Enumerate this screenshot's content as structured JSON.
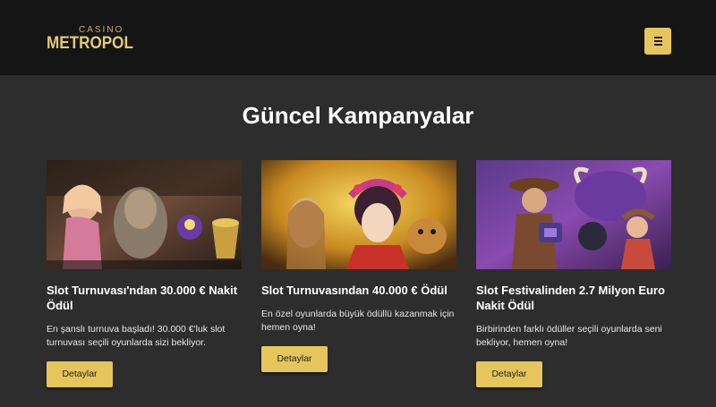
{
  "header": {
    "logo_top": "CASINO",
    "logo_main": "METROPOL",
    "menu_icon": "hamburger-menu-icon"
  },
  "page": {
    "title": "Güncel Kampanyalar"
  },
  "campaigns": [
    {
      "title": "Slot Turnuvası'ndan 30.000 € Nakit Ödül",
      "description": "En şanslı turnuva başladı! 30.000 €'luk slot turnuvası seçili oyunlarda sizi bekliyor.",
      "button": "Detaylar"
    },
    {
      "title": "Slot Turnuvasından 40.000 € Ödül",
      "description": "En özel oyunlarda büyük ödüllü kazanmak için hemen oyna!",
      "button": "Detaylar"
    },
    {
      "title": "Slot Festivalinden 2.7 Milyon Euro Nakit Ödül",
      "description": "Birbirinden farklı ödüller seçili oyunlarda seni bekliyor, hemen oyna!",
      "button": "Detaylar"
    }
  ],
  "colors": {
    "header_bg": "#151515",
    "page_bg": "#2d2d2d",
    "accent_gold": "#e6c65c"
  }
}
